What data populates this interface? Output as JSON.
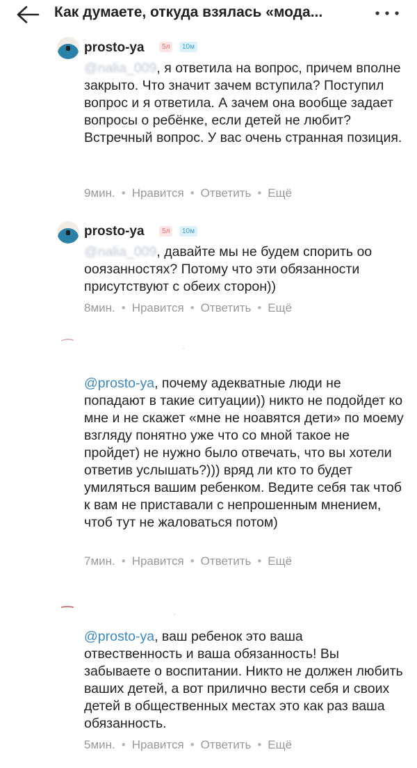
{
  "header": {
    "title": "Как думаете, откуда взялась «мода...",
    "back_icon": "arrow-left-icon",
    "more_icon": "more-dots-icon"
  },
  "comments": [
    {
      "username": "prosto-ya",
      "badge_age": "5л",
      "badge_months": "10м",
      "mention_blurred": "@nalia_009",
      "text": ", я ответила на вопрос, причем вполне закрыто. Что значит зачем вступила? Поступил вопрос и я ответила. А зачем она вообще задает вопросы о ребёнке, если детей не любит? Встречный вопрос. У вас очень странная позиция.",
      "time": "9мин.",
      "like": "Нравится",
      "reply": "Ответить",
      "more": "Ещё"
    },
    {
      "username": "prosto-ya",
      "badge_age": "5л",
      "badge_months": "10м",
      "mention_blurred": "@nalia_009",
      "text": ", давайте мы не будем спорить оо ооязанностях? Потому что эти обязанности присутствуют с обеих сторон))",
      "time": "8мин.",
      "like": "Нравится",
      "reply": "Ответить",
      "more": "Ещё"
    },
    {
      "mention": "@prosto-ya",
      "text": ", почему адекватные люди не попадают в такие ситуации)) никто не подойдет ко мне и не скажет «мне не ноавятся дети» по моему взгляду понятно уже что со мной такое не пройдет) не нужно было отвечать, что вы хотели ответив услышать?))) вряд ли кто то будет умиляться вашим ребенком. Ведите себя так чтоб к вам не приставали с непрошенным мнением, чтоб тут не жаловаться потом)",
      "time": "7мин.",
      "like": "Нравится",
      "reply": "Ответить",
      "more": "Ещё"
    },
    {
      "mention": "@prosto-ya",
      "text": ", ваш ребенок это ваша отвественность и ваша обязанность! Вы забываете о воспитании. Никто не должен любить ваших детей, а вот прилично вести себя и своих детей в общественных местах это как раз ваша обязанность.",
      "time": "5мин.",
      "like": "Нравится",
      "reply": "Ответить",
      "more": "Ещё"
    }
  ]
}
